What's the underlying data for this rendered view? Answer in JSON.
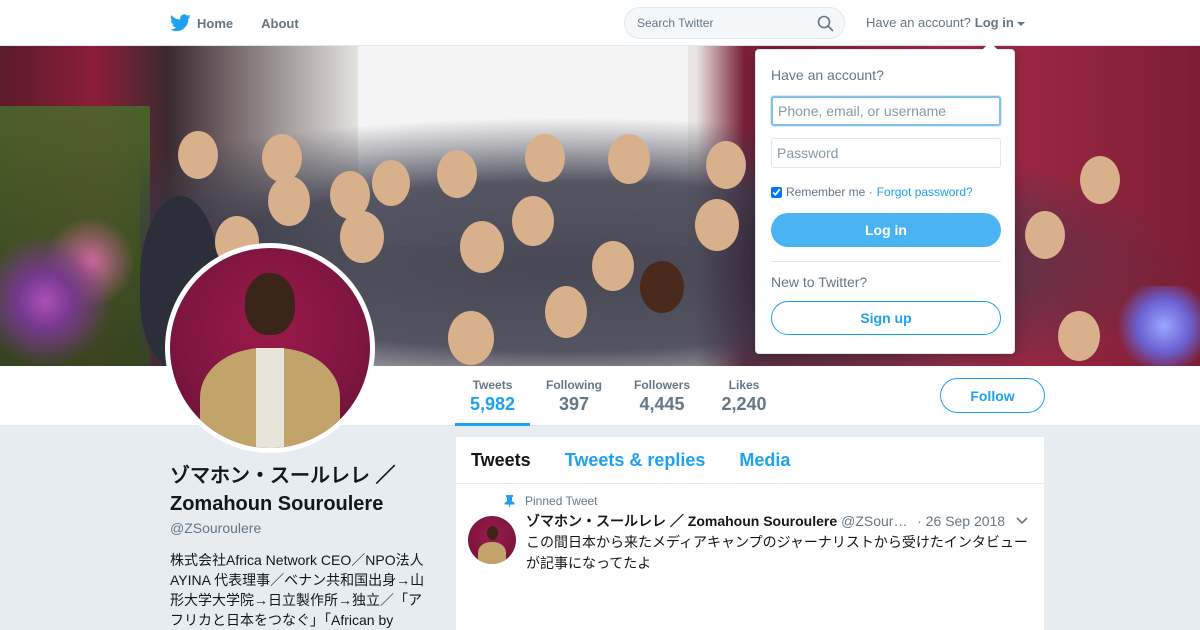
{
  "nav": {
    "home_label": "Home",
    "about_label": "About",
    "search_placeholder": "Search Twitter",
    "account_prompt": "Have an account?",
    "login_label": "Log in"
  },
  "profile": {
    "name": "ゾマホン・スールレレ ／ Zomahoun Souroulere",
    "name_line1": "ゾマホン・スールレレ ／",
    "name_line2": "Zomahoun Souroulere",
    "handle": "@ZSouroulere",
    "bio": "株式会社Africa Network CEO／NPO法人AYINA 代表理事／ベナン共和国出身→山形大学大学院→日立製作所→独立／「アフリカと日本をつなぐ」「African by"
  },
  "stats": [
    {
      "label": "Tweets",
      "value": "5,982",
      "active": true
    },
    {
      "label": "Following",
      "value": "397",
      "active": false
    },
    {
      "label": "Followers",
      "value": "4,445",
      "active": false
    },
    {
      "label": "Likes",
      "value": "2,240",
      "active": false
    }
  ],
  "follow_label": "Follow",
  "timeline": {
    "tabs": [
      "Tweets",
      "Tweets & replies",
      "Media"
    ],
    "tweet": {
      "pinned_label": "Pinned Tweet",
      "author_name": "ゾマホン・スールレレ ／ Zomahoun Souroulere",
      "author_handle": "@ZSouroulere",
      "date": "· 26 Sep 2018",
      "text": "この間日本から来たメディアキャンプのジャーナリストから受けたインタビューが記事になってたよ"
    }
  },
  "login_dropdown": {
    "title": "Have an account?",
    "username_placeholder": "Phone, email, or username",
    "password_placeholder": "Password",
    "remember_label": "Remember me ·",
    "forgot_label": "Forgot password?",
    "login_button": "Log in",
    "new_prompt": "New to Twitter?",
    "signup_button": "Sign up"
  },
  "colors": {
    "accent": "#1da1f2",
    "login_button": "#4ab3f4",
    "background": "#e6ecf0"
  }
}
